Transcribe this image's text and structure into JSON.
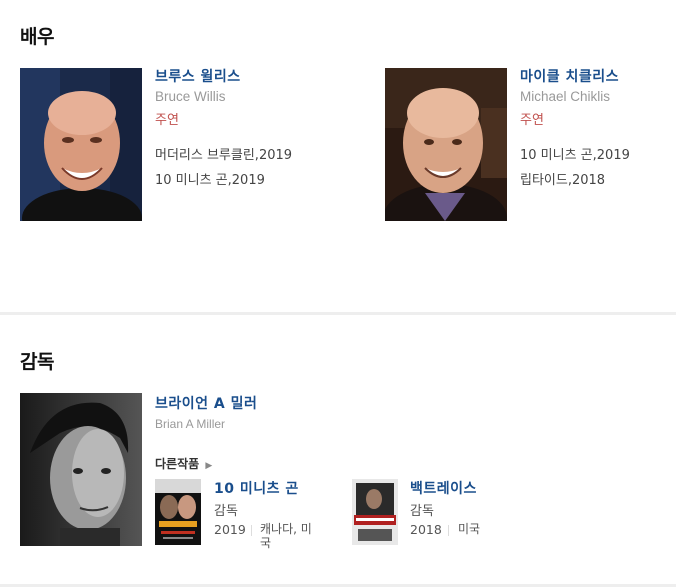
{
  "actors_section": {
    "title": "배우",
    "actors": [
      {
        "name_kr": "브루스 윌리스",
        "name_en": "Bruce Willis",
        "role": "주연",
        "films": [
          "머더리스 브루클린,2019",
          "10 미니츠 곤,2019"
        ]
      },
      {
        "name_kr": "마이클 치클리스",
        "name_en": "Michael Chiklis",
        "role": "주연",
        "films": [
          "10 미니츠 곤,2019",
          "립타이드,2018"
        ]
      }
    ]
  },
  "director_section": {
    "title": "감독",
    "director": {
      "name_kr": "브라이언 A 밀러",
      "name_en": "Brian A Miller",
      "more_works_label": "다른작품",
      "works": [
        {
          "title": "10 미니츠 곤",
          "role": "감독",
          "year": "2019",
          "country": "캐나다, 미국"
        },
        {
          "title": "백트레이스",
          "role": "감독",
          "year": "2018",
          "country": "미국"
        }
      ]
    }
  },
  "colors": {
    "name_link": "#1a4e8c",
    "role_red": "#c0504d",
    "divider": "#eeeeee"
  },
  "icons": {
    "more_arrow": "chevron-right-icon"
  }
}
